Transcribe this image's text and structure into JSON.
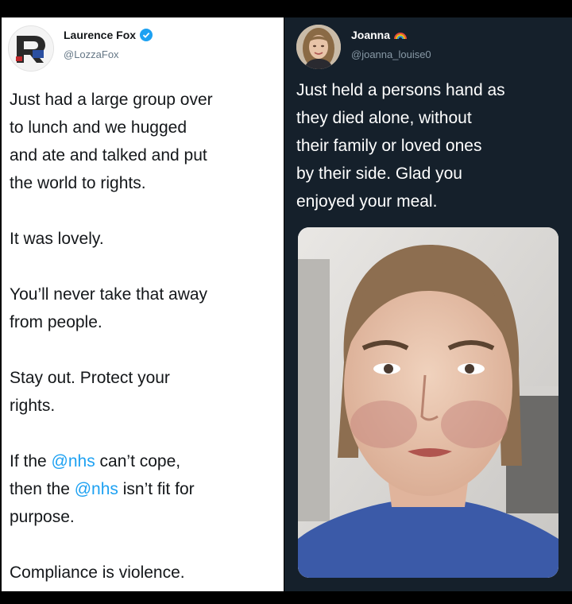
{
  "left_tweet": {
    "display_name": "Laurence Fox",
    "handle": "@LozzaFox",
    "verified_icon": "verified-badge-icon",
    "avatar_icon": "reclaim-logo-avatar",
    "lines": [
      {
        "text": "Just had a large group over"
      },
      {
        "text": "to lunch and we hugged"
      },
      {
        "text": "and ate and talked and put"
      },
      {
        "text": "the world to rights."
      },
      {
        "gap": true
      },
      {
        "text": "It was lovely."
      },
      {
        "gap": true
      },
      {
        "text": "You’ll never take that away"
      },
      {
        "text": "from people."
      },
      {
        "gap": true
      },
      {
        "text": "Stay out. Protect your"
      },
      {
        "text": "rights."
      },
      {
        "gap": true
      },
      {
        "pre": "If the ",
        "mention": "@nhs",
        "post": " can’t cope,"
      },
      {
        "pre": "then the ",
        "mention": "@nhs",
        "post": " isn’t fit for"
      },
      {
        "text": "purpose."
      },
      {
        "gap": true
      },
      {
        "text": "Compliance is violence."
      }
    ],
    "colors": {
      "background": "#ffffff",
      "text": "#14171a",
      "mention": "#1da1f2",
      "handle": "#657786"
    }
  },
  "right_tweet": {
    "display_name": "Joanna",
    "name_icon": "rainbow-icon",
    "handle": "@joanna_louise0",
    "avatar_icon": "profile-photo-avatar",
    "lines": [
      "Just held a persons hand as",
      "they died alone, without",
      "their family or loved ones",
      "by their side. Glad you",
      "enjoyed your meal."
    ],
    "photo": "selfie-photo",
    "colors": {
      "background": "#15202b",
      "text": "#ffffff",
      "handle": "#8899a6"
    }
  }
}
